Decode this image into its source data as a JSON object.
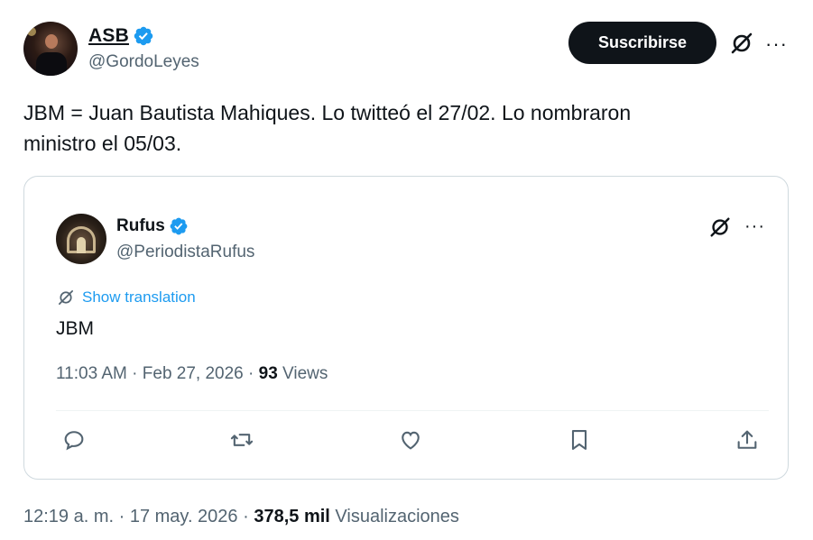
{
  "main_tweet": {
    "author_name": "ASB",
    "author_handle": "@GordoLeyes",
    "subscribe_label": "Suscribirse",
    "more_label": "···",
    "text_line1": "JBM = Juan Bautista Mahiques. Lo twitteó el 27/02. Lo nombraron",
    "text_line2": "ministro el 05/03.",
    "footer": {
      "time": "12:19 a. m.",
      "sep1": " · ",
      "date": "17 may. 2026",
      "sep2": " · ",
      "views_count": "378,5 mil",
      "views_label": " Visualizaciones"
    }
  },
  "quoted_tweet": {
    "author_name": "Rufus",
    "author_handle": "@PeriodistaRufus",
    "more_label": "···",
    "translation_label": "Show translation",
    "text": "JBM",
    "meta": {
      "time": "11:03 AM",
      "sep1": " · ",
      "date": "Feb 27, 2026",
      "sep2": " · ",
      "views_count": "93",
      "views_label": " Views"
    },
    "actions": [
      "reply-icon",
      "retweet-icon",
      "like-icon",
      "bookmark-icon",
      "share-icon"
    ]
  },
  "colors": {
    "accent": "#1d9bf0",
    "text_primary": "#0f1419",
    "text_secondary": "#536471",
    "border": "#cfd9de"
  }
}
